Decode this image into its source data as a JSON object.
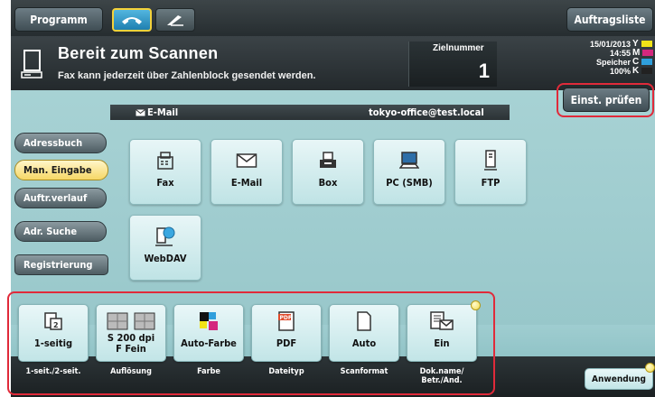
{
  "topbar": {
    "programm_label": "Programm",
    "auftragsliste_label": "Auftragsliste"
  },
  "status": {
    "title": "Bereit zum Scannen",
    "subtitle": "Fax kann jederzeit über Zahlenblock gesendet werden.",
    "zielnummer_label": "Zielnummer",
    "zielnummer_value": "1",
    "date": "15/01/2013",
    "time": "14:55",
    "speicher_label": "Speicher",
    "memory_value": "100%",
    "toner": [
      {
        "letter": "Y",
        "color": "#f2e418"
      },
      {
        "letter": "M",
        "color": "#d4287e"
      },
      {
        "letter": "C",
        "color": "#2f9fdc"
      },
      {
        "letter": "K",
        "color": "#222222"
      }
    ],
    "check_settings_label": "Einst. prüfen"
  },
  "destination": {
    "type_label": "E-Mail",
    "address": "tokyo-office@test.local"
  },
  "sidebar": [
    {
      "label": "Adressbuch",
      "active": false
    },
    {
      "label": "Man. Eingabe",
      "active": true
    },
    {
      "label": "Auftr.verlauf",
      "active": false
    },
    {
      "label": "Adr. Suche",
      "active": false
    },
    {
      "label": "Registrierung",
      "active": false
    }
  ],
  "destinations": [
    {
      "label": "Fax",
      "icon": "fax-icon"
    },
    {
      "label": "E-Mail",
      "icon": "envelope-icon"
    },
    {
      "label": "Box",
      "icon": "box-icon"
    },
    {
      "label": "PC (SMB)",
      "icon": "computer-icon"
    },
    {
      "label": "FTP",
      "icon": "ftp-server-icon"
    },
    {
      "label": "WebDAV",
      "icon": "webdav-icon"
    }
  ],
  "options": [
    {
      "value": "1-seitig",
      "label": "1-seit./2-seit.",
      "icon": "simplex-icon"
    },
    {
      "value": "S 200 dpi\nF Fein",
      "label": "Auflösung",
      "icon": "resolution-icon"
    },
    {
      "value": "Auto-Farbe",
      "label": "Farbe",
      "icon": "color-icon"
    },
    {
      "value": "PDF",
      "label": "Dateityp",
      "icon": "pdf-icon"
    },
    {
      "value": "Auto",
      "label": "Scanformat",
      "icon": "page-icon"
    },
    {
      "value": "Ein",
      "label": "Dok.name/\nBetr./And.",
      "icon": "document-mail-icon"
    }
  ],
  "anwendung_label": "Anwendung",
  "colors": {
    "highlight": "#e02a3a",
    "panel": "#a7d2d4",
    "active_pill": "#f6d766"
  }
}
